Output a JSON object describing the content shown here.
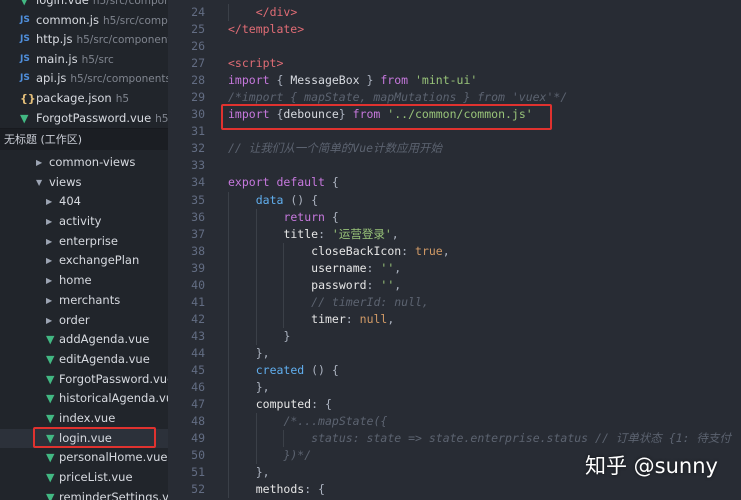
{
  "open_editors": [
    {
      "icon": "vue",
      "name": "login.vue",
      "path": "h5/src/compon..."
    },
    {
      "icon": "js",
      "name": "common.js",
      "path": "h5/src/comp..."
    },
    {
      "icon": "js",
      "name": "http.js",
      "path": "h5/src/component..."
    },
    {
      "icon": "js",
      "name": "main.js",
      "path": "h5/src"
    },
    {
      "icon": "js",
      "name": "api.js",
      "path": "h5/src/components..."
    },
    {
      "icon": "json",
      "name": "package.json",
      "path": "h5"
    },
    {
      "icon": "vue",
      "name": "ForgotPassword.vue",
      "path": "h5/..."
    }
  ],
  "workspace_header": "无标题 (工作区)",
  "tree": [
    {
      "name": "common-views",
      "type": "folder",
      "state": "collapsed",
      "depth": 1
    },
    {
      "name": "views",
      "type": "folder",
      "state": "expanded",
      "depth": 1
    },
    {
      "name": "404",
      "type": "folder",
      "state": "collapsed",
      "depth": 2
    },
    {
      "name": "activity",
      "type": "folder",
      "state": "collapsed",
      "depth": 2
    },
    {
      "name": "enterprise",
      "type": "folder",
      "state": "collapsed",
      "depth": 2
    },
    {
      "name": "exchangePlan",
      "type": "folder",
      "state": "collapsed",
      "depth": 2
    },
    {
      "name": "home",
      "type": "folder",
      "state": "collapsed",
      "depth": 2
    },
    {
      "name": "merchants",
      "type": "folder",
      "state": "collapsed",
      "depth": 2
    },
    {
      "name": "order",
      "type": "folder",
      "state": "collapsed",
      "depth": 2
    },
    {
      "name": "addAgenda.vue",
      "type": "vue",
      "depth": 2
    },
    {
      "name": "editAgenda.vue",
      "type": "vue",
      "depth": 2
    },
    {
      "name": "ForgotPassword.vue",
      "type": "vue",
      "depth": 2
    },
    {
      "name": "historicalAgenda.vue",
      "type": "vue",
      "depth": 2
    },
    {
      "name": "index.vue",
      "type": "vue",
      "depth": 2
    },
    {
      "name": "login.vue",
      "type": "vue",
      "depth": 2,
      "selected": true
    },
    {
      "name": "personalHome.vue",
      "type": "vue",
      "depth": 2
    },
    {
      "name": "priceList.vue",
      "type": "vue",
      "depth": 2
    },
    {
      "name": "reminderSettings.v",
      "type": "vue",
      "depth": 2
    }
  ],
  "code_lines": [
    {
      "n": "24",
      "indent": 1,
      "tokens": [
        [
          "tag",
          "</div>"
        ]
      ]
    },
    {
      "n": "25",
      "indent": 0,
      "tokens": [
        [
          "tag",
          "</template>"
        ]
      ]
    },
    {
      "n": "26",
      "indent": 0,
      "tokens": []
    },
    {
      "n": "27",
      "indent": 0,
      "tokens": [
        [
          "tag",
          "<script>"
        ]
      ]
    },
    {
      "n": "28",
      "indent": 0,
      "tokens": [
        [
          "kw",
          "import"
        ],
        [
          "punc",
          " { "
        ],
        [
          "plain",
          "MessageBox"
        ],
        [
          "punc",
          " } "
        ],
        [
          "kw",
          "from"
        ],
        [
          "punc",
          " "
        ],
        [
          "str",
          "'mint-ui'"
        ]
      ]
    },
    {
      "n": "29",
      "indent": 0,
      "tokens": [
        [
          "com",
          "/*import { mapState, mapMutations } from 'vuex'*/"
        ]
      ]
    },
    {
      "n": "30",
      "indent": 0,
      "tokens": [
        [
          "kw",
          "import"
        ],
        [
          "punc",
          " {"
        ],
        [
          "plain",
          "debounce"
        ],
        [
          "punc",
          "} "
        ],
        [
          "kw",
          "from"
        ],
        [
          "punc",
          " "
        ],
        [
          "str",
          "'../common/common.js'"
        ]
      ]
    },
    {
      "n": "31",
      "indent": 0,
      "tokens": []
    },
    {
      "n": "32",
      "indent": 0,
      "tokens": [
        [
          "com",
          "// 让我们从一个简单的Vue计数应用开始"
        ]
      ]
    },
    {
      "n": "33",
      "indent": 0,
      "tokens": []
    },
    {
      "n": "34",
      "indent": 0,
      "tokens": [
        [
          "kw",
          "export"
        ],
        [
          "punc",
          " "
        ],
        [
          "kw",
          "default"
        ],
        [
          "punc",
          " {"
        ]
      ]
    },
    {
      "n": "35",
      "indent": 1,
      "tokens": [
        [
          "fn",
          "data"
        ],
        [
          "punc",
          " () {"
        ]
      ]
    },
    {
      "n": "36",
      "indent": 2,
      "tokens": [
        [
          "kw",
          "return"
        ],
        [
          "punc",
          " {"
        ]
      ]
    },
    {
      "n": "37",
      "indent": 2,
      "tokens": [
        [
          "key",
          "title"
        ],
        [
          "punc",
          ": "
        ],
        [
          "str",
          "'运营登录'"
        ],
        [
          "punc",
          ","
        ]
      ]
    },
    {
      "n": "38",
      "indent": 3,
      "tokens": [
        [
          "key",
          "closeBackIcon"
        ],
        [
          "punc",
          ": "
        ],
        [
          "bool",
          "true"
        ],
        [
          "punc",
          ","
        ]
      ]
    },
    {
      "n": "39",
      "indent": 3,
      "tokens": [
        [
          "key",
          "username"
        ],
        [
          "punc",
          ": "
        ],
        [
          "str",
          "''"
        ],
        [
          "punc",
          ","
        ]
      ]
    },
    {
      "n": "40",
      "indent": 3,
      "tokens": [
        [
          "key",
          "password"
        ],
        [
          "punc",
          ": "
        ],
        [
          "str",
          "''"
        ],
        [
          "punc",
          ","
        ]
      ]
    },
    {
      "n": "41",
      "indent": 3,
      "tokens": [
        [
          "com",
          "// timerId: null,"
        ]
      ]
    },
    {
      "n": "42",
      "indent": 3,
      "tokens": [
        [
          "key",
          "timer"
        ],
        [
          "punc",
          ": "
        ],
        [
          "bool",
          "null"
        ],
        [
          "punc",
          ","
        ]
      ]
    },
    {
      "n": "43",
      "indent": 2,
      "tokens": [
        [
          "punc",
          "}"
        ]
      ]
    },
    {
      "n": "44",
      "indent": 1,
      "tokens": [
        [
          "punc",
          "},"
        ]
      ]
    },
    {
      "n": "45",
      "indent": 1,
      "tokens": [
        [
          "fn",
          "created"
        ],
        [
          "punc",
          " () {"
        ]
      ]
    },
    {
      "n": "46",
      "indent": 1,
      "tokens": [
        [
          "punc",
          "},"
        ]
      ]
    },
    {
      "n": "47",
      "indent": 1,
      "tokens": [
        [
          "key",
          "computed"
        ],
        [
          "punc",
          ": {"
        ]
      ]
    },
    {
      "n": "48",
      "indent": 2,
      "tokens": [
        [
          "com",
          "/*...mapState({"
        ]
      ]
    },
    {
      "n": "49",
      "indent": 3,
      "tokens": [
        [
          "com",
          "status: state => state.enterprise.status // 订单状态 {1: 待支付"
        ]
      ]
    },
    {
      "n": "50",
      "indent": 2,
      "tokens": [
        [
          "com",
          "})*/"
        ]
      ]
    },
    {
      "n": "51",
      "indent": 1,
      "tokens": [
        [
          "punc",
          "},"
        ]
      ]
    },
    {
      "n": "52",
      "indent": 1,
      "tokens": [
        [
          "key",
          "methods"
        ],
        [
          "punc",
          ": {"
        ]
      ]
    }
  ],
  "watermark": "知乎 @sunny",
  "colors": {
    "highlight_box": "#e0322f",
    "vue_icon": "#42b883",
    "js_icon": "#4f8fdc"
  }
}
